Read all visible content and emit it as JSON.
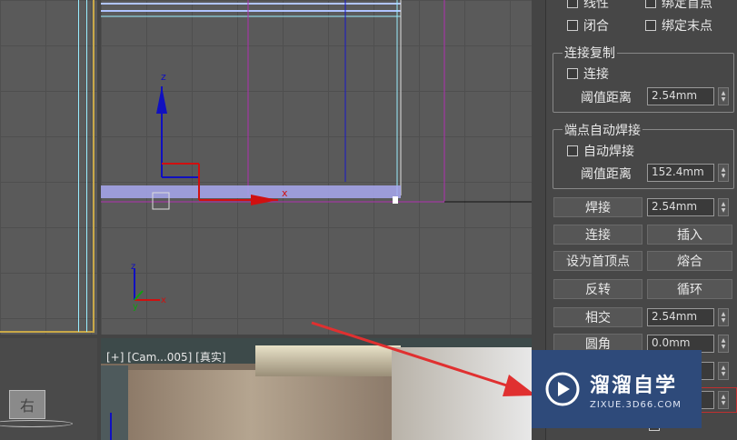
{
  "viewport_left": {
    "view_cube_label": "右"
  },
  "viewport_camera": {
    "label": "[+] [Cam...005] [真实]"
  },
  "axis": {
    "z": "z",
    "x": "x",
    "y": "y"
  },
  "panel": {
    "top": {
      "linear": "线性",
      "bind_first": "绑定首点",
      "closed": "闭合",
      "bind_last": "绑定末点"
    },
    "connect_copy": {
      "title": "连接复制",
      "connect": "连接",
      "threshold_label": "阈值距离",
      "threshold_value": "2.54mm"
    },
    "endpoint_weld": {
      "title": "端点自动焊接",
      "auto_weld": "自动焊接",
      "threshold_label": "阈值距离",
      "threshold_value": "152.4mm"
    },
    "ops": {
      "weld": "焊接",
      "weld_value": "2.54mm",
      "connect": "连接",
      "insert": "插入",
      "make_first": "设为首顶点",
      "fuse": "熔合",
      "reverse": "反转",
      "cycle": "循环",
      "intersect": "相交",
      "intersect_value": "2.54mm",
      "fillet": "圆角",
      "fillet_value": "0.0mm"
    }
  },
  "watermark": {
    "title": "溜溜自学",
    "url": "ZIXUE.3D66.COM"
  },
  "colors": {
    "arrow": "#e03030",
    "axis_blue": "#1010c0",
    "axis_red": "#d01010",
    "selection": "#b0b0ff"
  }
}
